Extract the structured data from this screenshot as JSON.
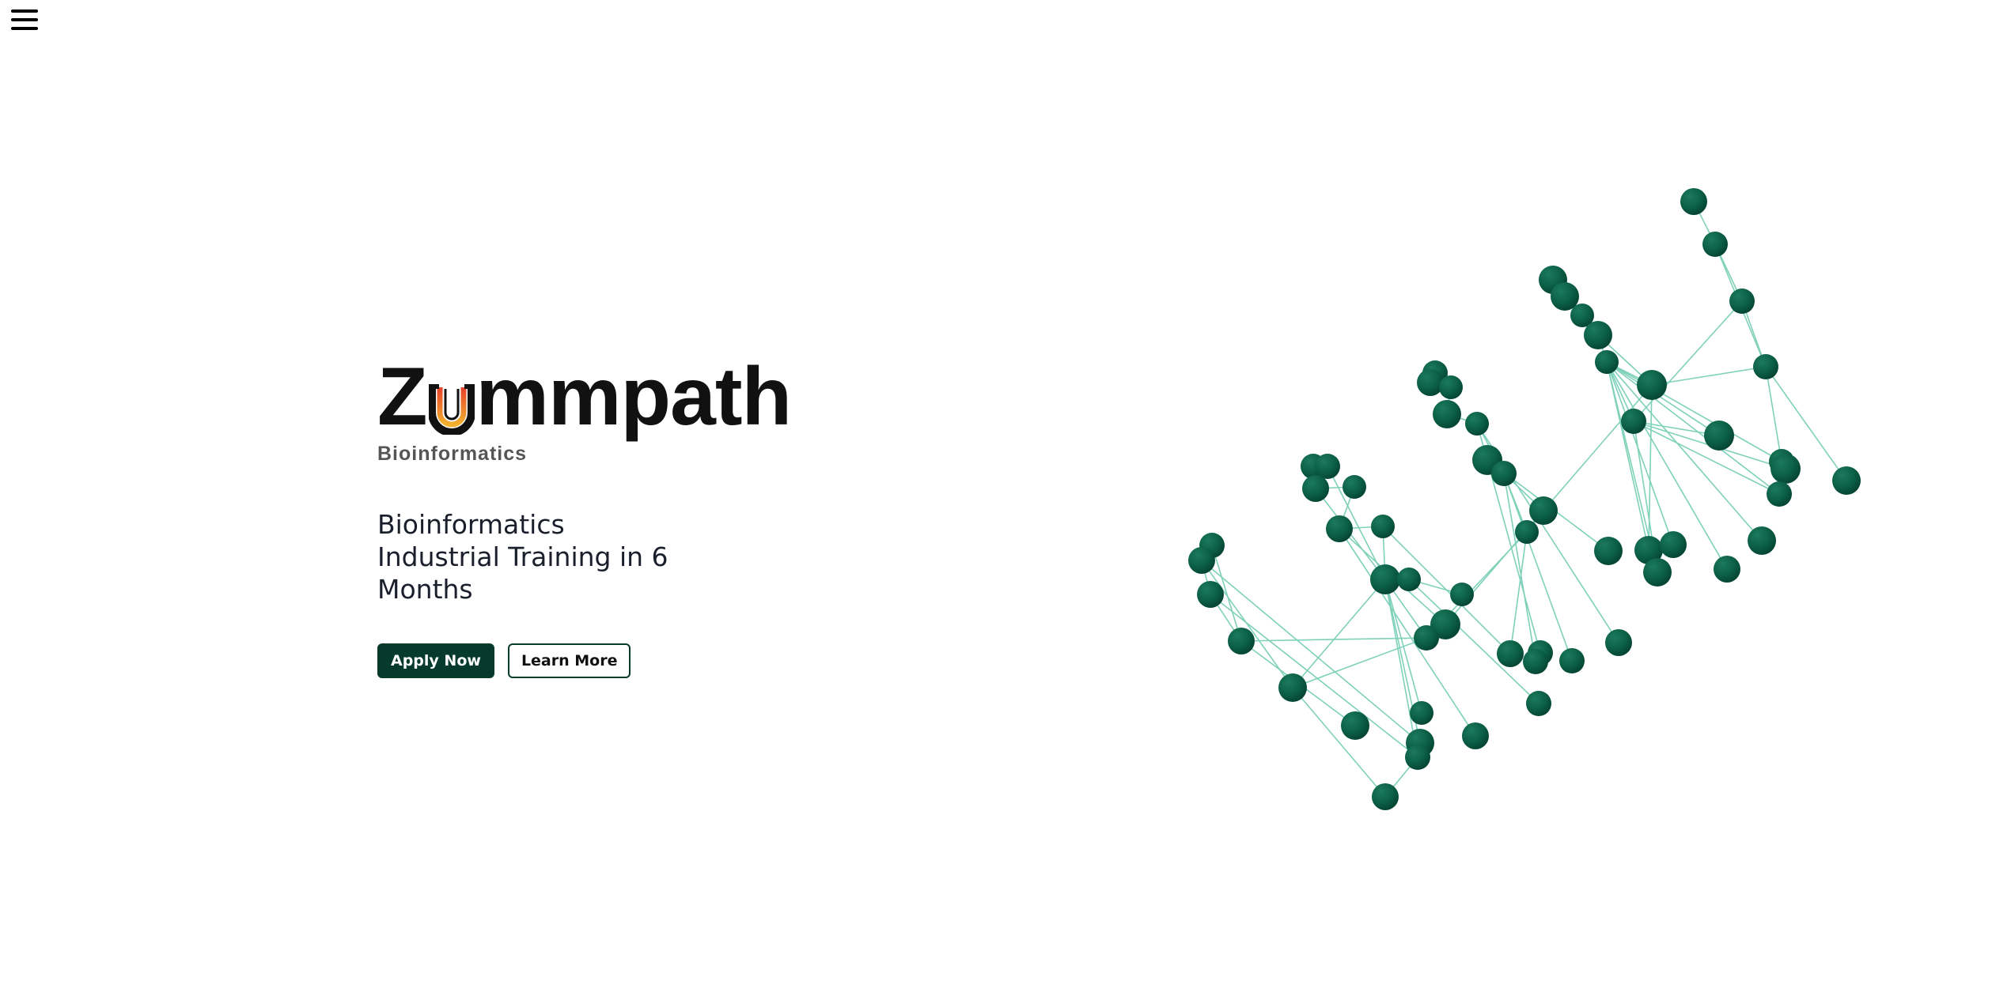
{
  "menu": {
    "icon": "hamburger-menu-icon"
  },
  "logo": {
    "prefix": "Z",
    "suffix": "mmpath",
    "subtitle": "Bioinformatics",
    "icon": "magnet-u-icon"
  },
  "hero": {
    "tagline": "Bioinformatics Industrial Training in 6 Months",
    "apply_label": "Apply Now",
    "learn_label": "Learn More"
  },
  "colors": {
    "accent": "#053a2c",
    "node": "#0b5e45",
    "edge": "#7fd1b9",
    "text": "#1a1f2b"
  },
  "network_graphic": {
    "icon": "molecular-network-graphic"
  }
}
